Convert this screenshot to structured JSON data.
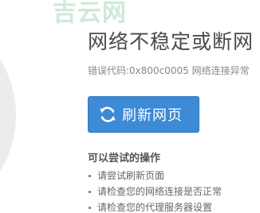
{
  "watermark": {
    "text": "吉云网"
  },
  "error": {
    "title": "网络不稳定或断网",
    "code_text": "错误代码:0x800c0005 网络连接异常"
  },
  "refresh_button": {
    "label": "刷新网页",
    "icon": "refresh-icon",
    "color": "#3d8ad6"
  },
  "suggestions": {
    "heading": "可以尝试的操作",
    "items": [
      "请尝试刷新页面",
      "请检查您的网络连接是否正常",
      "请检查您的代理服务器设置"
    ]
  }
}
